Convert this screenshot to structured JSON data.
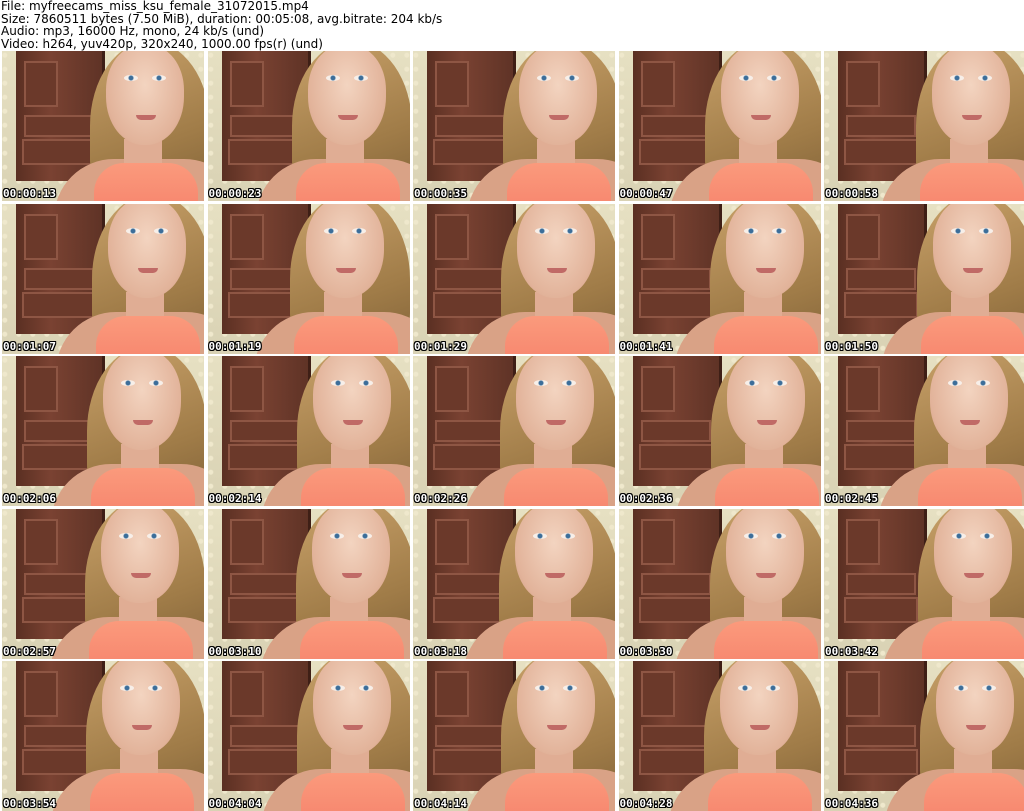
{
  "header": {
    "file_line": "File: myfreecams_miss_ksu_female_31072015.mp4",
    "size_line": "Size: 7860511 bytes (7.50 MiB), duration: 00:05:08, avg.bitrate: 204 kb/s",
    "audio_line": "Audio: mp3, 16000 Hz, mono, 24 kb/s (und)",
    "video_line": "Video: h264, yuv420p, 320x240, 1000.00 fps(r) (und)"
  },
  "colors": {
    "background": "#ffffff",
    "timestamp_text": "#ffffff",
    "timestamp_outline": "#000000",
    "tank_top": "#f5806a",
    "cabinet": "#6b392a"
  },
  "frames": [
    {
      "time": "00:00:13"
    },
    {
      "time": "00:00:23"
    },
    {
      "time": "00:00:35"
    },
    {
      "time": "00:00:47"
    },
    {
      "time": "00:00:58"
    },
    {
      "time": "00:01:07"
    },
    {
      "time": "00:01:19"
    },
    {
      "time": "00:01:29"
    },
    {
      "time": "00:01:41"
    },
    {
      "time": "00:01:50"
    },
    {
      "time": "00:02:06"
    },
    {
      "time": "00:02:14"
    },
    {
      "time": "00:02:26"
    },
    {
      "time": "00:02:36"
    },
    {
      "time": "00:02:45"
    },
    {
      "time": "00:02:57"
    },
    {
      "time": "00:03:10"
    },
    {
      "time": "00:03:18"
    },
    {
      "time": "00:03:30"
    },
    {
      "time": "00:03:42"
    },
    {
      "time": "00:03:54"
    },
    {
      "time": "00:04:04"
    },
    {
      "time": "00:04:14"
    },
    {
      "time": "00:04:28"
    },
    {
      "time": "00:04:36"
    }
  ]
}
